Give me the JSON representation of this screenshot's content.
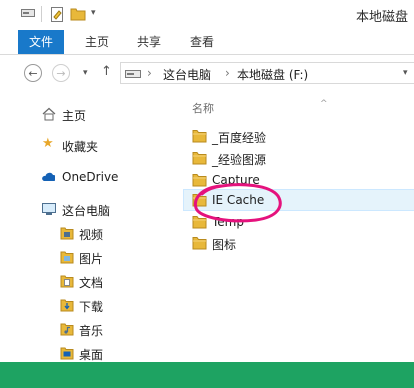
{
  "window": {
    "title": "本地磁盘"
  },
  "quick_access": {
    "icons": [
      "drive-icon",
      "properties-icon",
      "new-folder-icon",
      "customize-dropdown-icon"
    ]
  },
  "ribbon": {
    "tabs": [
      "文件",
      "主页",
      "共享",
      "查看"
    ]
  },
  "navigation": {
    "back": "←",
    "forward": "→",
    "recent": "▾",
    "up": "↑",
    "breadcrumb": [
      "这台电脑",
      "本地磁盘 (F:)"
    ],
    "separator": "›",
    "dropdown": "▾"
  },
  "sidebar": {
    "items": [
      {
        "label": "主页",
        "icon": "home-icon"
      },
      {
        "label": "收藏夹",
        "icon": "star-icon"
      },
      {
        "label": "OneDrive",
        "icon": "cloud-icon"
      },
      {
        "label": "这台电脑",
        "icon": "computer-icon"
      },
      {
        "label": "视频",
        "icon": "video-library-icon"
      },
      {
        "label": "图片",
        "icon": "pictures-library-icon"
      },
      {
        "label": "文档",
        "icon": "documents-library-icon"
      },
      {
        "label": "下载",
        "icon": "downloads-library-icon"
      },
      {
        "label": "音乐",
        "icon": "music-library-icon"
      },
      {
        "label": "桌面",
        "icon": "desktop-library-icon"
      }
    ]
  },
  "files": {
    "column_header": "名称",
    "sort_indicator": "^",
    "items": [
      {
        "name": "_百度经验",
        "selected": false
      },
      {
        "name": "_经验图源",
        "selected": false
      },
      {
        "name": "Capture",
        "selected": false
      },
      {
        "name": "IE Cache",
        "selected": true
      },
      {
        "name": "Temp",
        "selected": false
      },
      {
        "name": "图标",
        "selected": false
      }
    ]
  },
  "colors": {
    "accent": "#1979ca",
    "selection": "#e5f3fb",
    "annotation": "#e5127d",
    "status_bar": "#1ea362",
    "folder": "#e8b83a"
  }
}
